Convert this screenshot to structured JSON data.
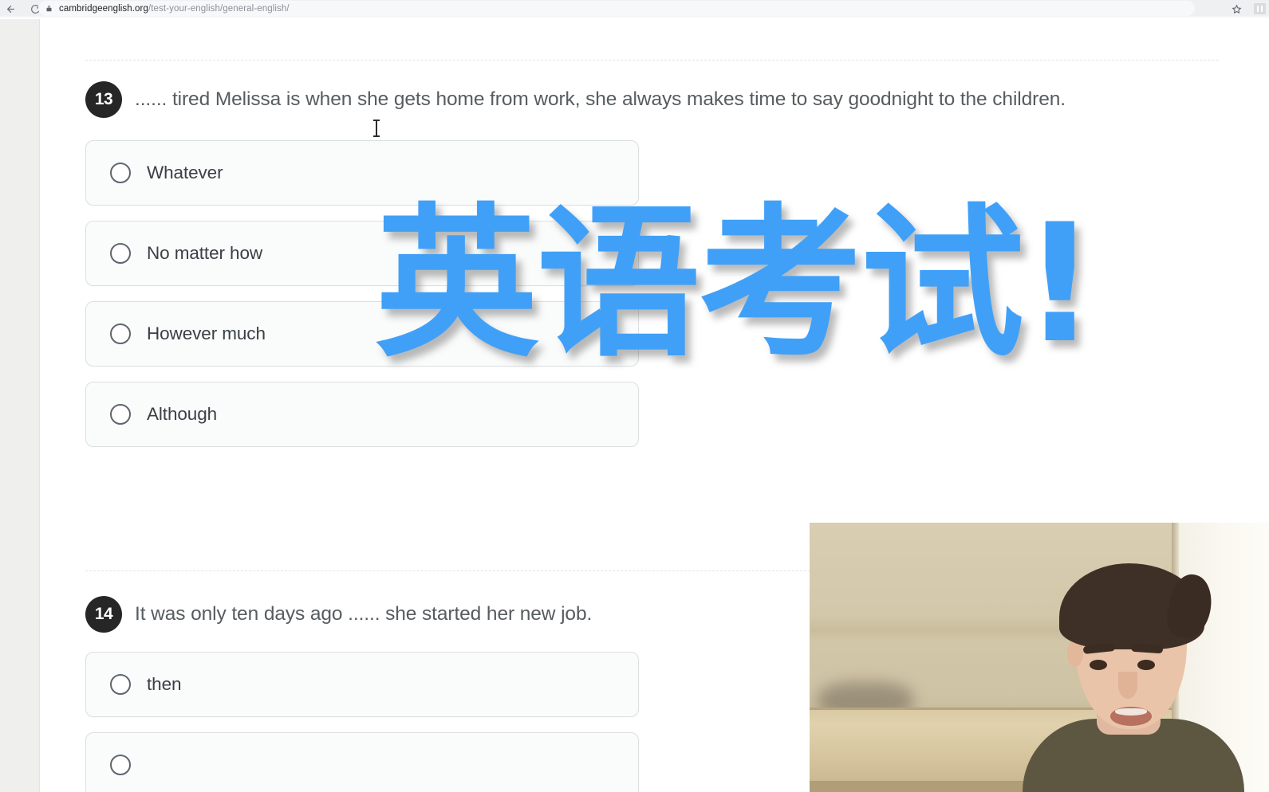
{
  "browser": {
    "back_icon": "back-arrow-icon",
    "reload_icon": "reload-icon",
    "lock_icon": "lock-icon",
    "url_domain": "cambridgeenglish.org",
    "url_path": "/test-your-english/general-english/",
    "bookmark_icon": "star-icon",
    "extension_icon": "extension-icon"
  },
  "overlay": {
    "title": "英语考试!",
    "color": "#40a0f7"
  },
  "questions": [
    {
      "number": "13",
      "text": "...... tired Melissa is when she gets home from work, she always makes time to say goodnight to the children.",
      "options": [
        {
          "label": "Whatever",
          "selected": false
        },
        {
          "label": "No matter how",
          "selected": false
        },
        {
          "label": "However much",
          "selected": false
        },
        {
          "label": "Although",
          "selected": false
        }
      ]
    },
    {
      "number": "14",
      "text": "It was only ten days ago ...... she started her new job.",
      "options": [
        {
          "label": "then",
          "selected": false
        },
        {
          "label": "",
          "selected": false
        }
      ]
    }
  ],
  "webcam": {
    "label": "presenter-webcam"
  }
}
